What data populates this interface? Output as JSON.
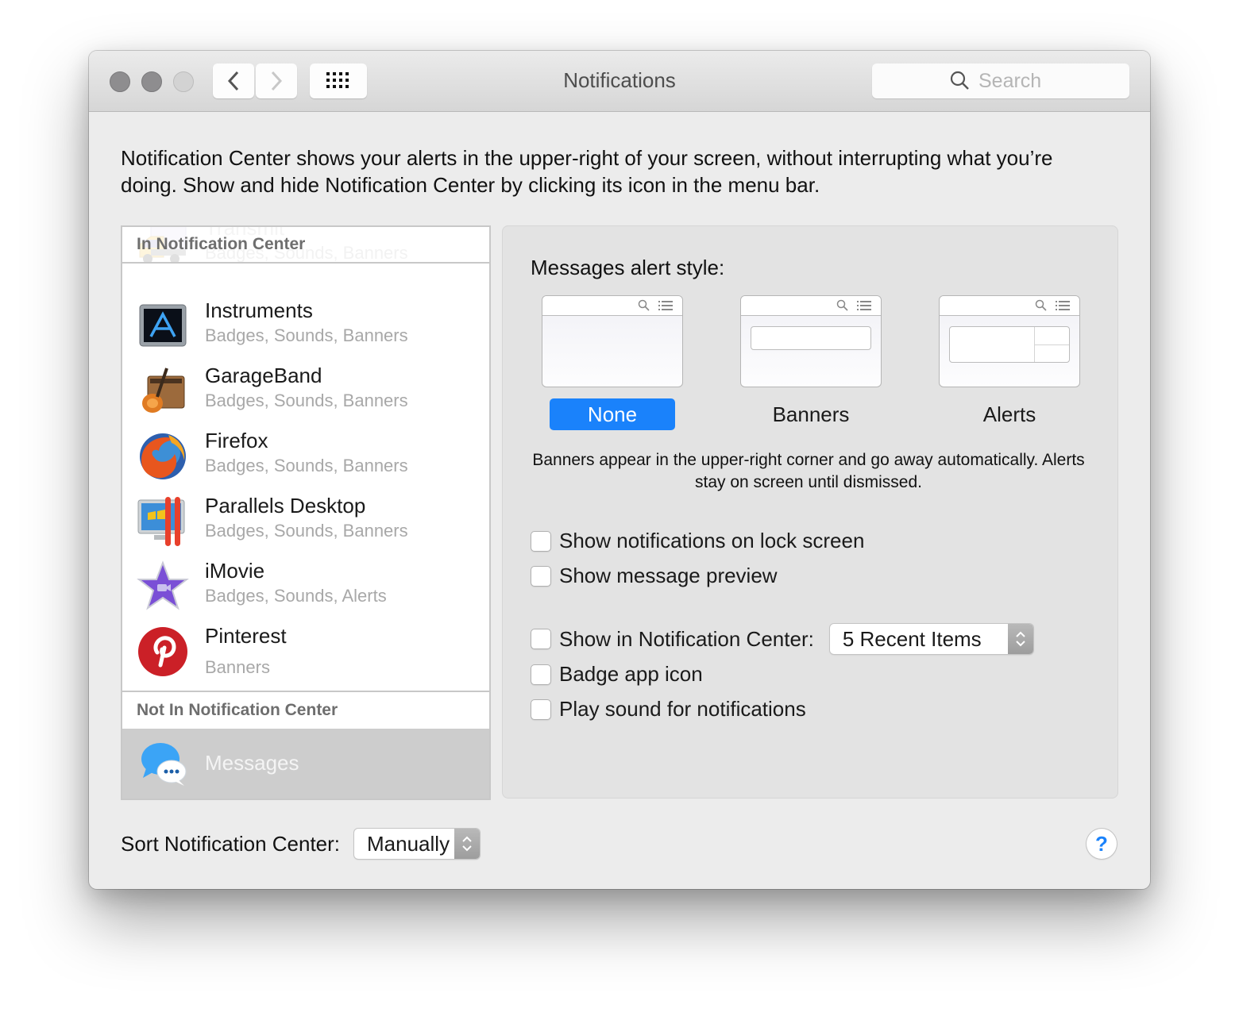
{
  "window": {
    "title": "Notifications",
    "search_placeholder": "Search"
  },
  "intro_text": "Notification Center shows your alerts in the upper-right of your screen, without interrupting what you’re doing. Show and hide Notification Center by clicking its icon in the menu bar.",
  "app_list": {
    "in_header": "In Notification Center",
    "not_in_header": "Not In Notification Center",
    "items": [
      {
        "name": "Transmit",
        "detail": "Badges, Sounds, Banners",
        "icon": "transmit-truck-icon"
      },
      {
        "name": "Instruments",
        "detail": "Badges, Sounds, Banners",
        "icon": "instruments-icon"
      },
      {
        "name": "GarageBand",
        "detail": "Badges, Sounds, Banners",
        "icon": "garageband-guitar-icon"
      },
      {
        "name": "Firefox",
        "detail": "Badges, Sounds, Banners",
        "icon": "firefox-icon"
      },
      {
        "name": "Parallels Desktop",
        "detail": "Badges, Sounds, Banners",
        "icon": "parallels-icon"
      },
      {
        "name": "iMovie",
        "detail": "Badges, Sounds, Alerts",
        "icon": "imovie-star-icon"
      },
      {
        "name": "Pinterest",
        "detail": "Banners",
        "icon": "pinterest-icon"
      }
    ],
    "not_in_items": [
      {
        "name": "Messages",
        "icon": "messages-bubble-icon",
        "selected": true
      }
    ]
  },
  "settings": {
    "alert_style_label": "Messages alert style:",
    "styles": [
      {
        "label": "None",
        "selected": true
      },
      {
        "label": "Banners",
        "selected": false
      },
      {
        "label": "Alerts",
        "selected": false
      }
    ],
    "description": "Banners appear in the upper-right corner and go away automatically. Alerts stay on screen until dismissed.",
    "checkboxes": [
      {
        "label": "Show notifications on lock screen",
        "checked": false
      },
      {
        "label": "Show message preview",
        "checked": false
      },
      {
        "label": "Show in Notification Center:",
        "checked": false
      },
      {
        "label": "Badge app icon",
        "checked": false
      },
      {
        "label": "Play sound for notifications",
        "checked": false
      }
    ],
    "recent_items_value": "5 Recent Items"
  },
  "footer": {
    "sort_label": "Sort Notification Center:",
    "sort_value": "Manually",
    "help_label": "?"
  },
  "colors": {
    "accent": "#1a82fb",
    "selected_row": "#cdcdcd"
  }
}
